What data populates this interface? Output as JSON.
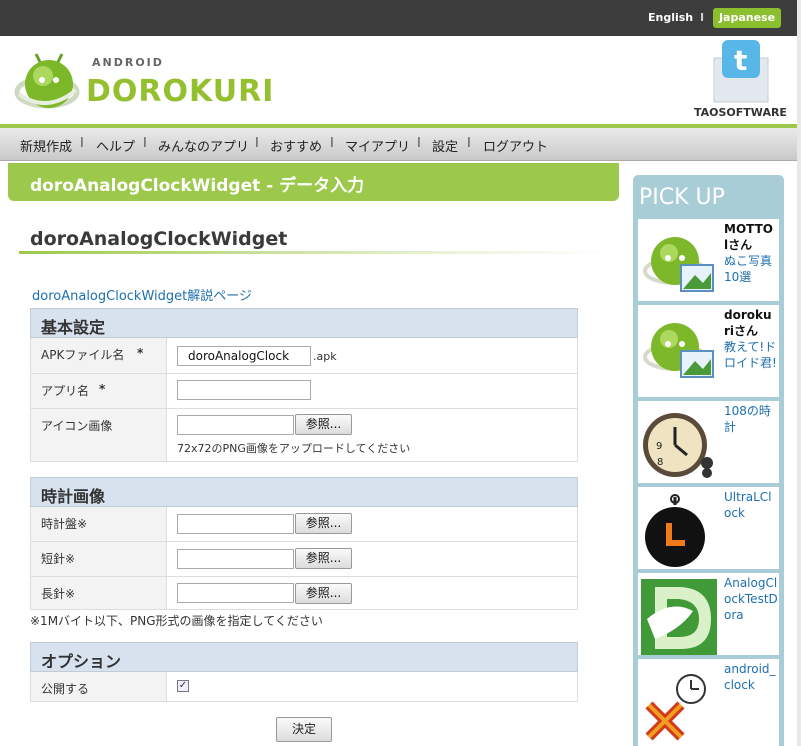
{
  "topbar": {
    "english": "English",
    "separator": "I",
    "japanese": "Japanese"
  },
  "header": {
    "brand_small": "ANDROID",
    "brand": "DOROKURI",
    "twitter_label": "TAOSOFTWARE"
  },
  "nav": {
    "items": [
      "新規作成",
      "ヘルプ",
      "みんなのアプリ",
      "おすすめ",
      "マイアプリ",
      "設定",
      "ログアウト"
    ],
    "separator": "I"
  },
  "title_band": "doroAnalogClockWidget - データ入力",
  "page_title": "doroAnalogClockWidget",
  "help_link": "doroAnalogClockWidget解説ページ",
  "basic": {
    "heading": "基本設定",
    "apk_label": "APKファイル名",
    "apk_value": "doroAnalogClock",
    "apk_suffix": ".apk",
    "app_label": "アプリ名",
    "icon_label": "アイコン画像",
    "icon_hint": "72x72のPNG画像をアップロードしてください",
    "required_mark": "*"
  },
  "clock": {
    "heading": "時計画像",
    "dial_label": "時計盤※",
    "short_label": "短針※",
    "long_label": "長針※",
    "note": "※1Mバイト以下、PNG形式の画像を指定してください"
  },
  "browse_label": "参照...",
  "options": {
    "heading": "オプション",
    "publish_label": "公開する",
    "publish_checked": true,
    "check_glyph": "✓"
  },
  "submit_label": "決定",
  "pickup": {
    "title": "PICK UP",
    "items": [
      {
        "author": "MOTTO",
        "author2": "lさん",
        "title": "ぬこ写真10選"
      },
      {
        "author": "doroku",
        "author2": "riさん",
        "title": "教えて!ドロイド君!"
      },
      {
        "author": "",
        "author2": "",
        "title": "108の時計"
      },
      {
        "author": "",
        "author2": "",
        "title": "UltraLClock"
      },
      {
        "author": "",
        "author2": "",
        "title": "AnalogClockTestDora"
      },
      {
        "author": "",
        "author2": "",
        "title": "android_clock"
      }
    ]
  },
  "colors": {
    "accent": "#9cc94b",
    "link": "#1d6fb0",
    "section_bg": "#d7e2ee",
    "sidebar": "#a9cdd6"
  }
}
